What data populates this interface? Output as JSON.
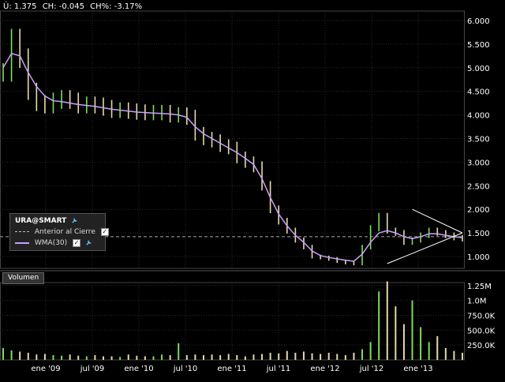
{
  "header": {
    "last_label": "Ú: 1.375",
    "change_label": "CH: -0.045",
    "change_pct_label": "CH%: -3.17%"
  },
  "legend": {
    "symbol": "URA@SMART",
    "prev_close_label": "Anterior al Cierre",
    "wma_label": "WMA(30)"
  },
  "volume_panel": {
    "title": "Volumen"
  },
  "colors": {
    "background": "#000000",
    "up": "#7ddc5a",
    "down": "#e8d8a8",
    "wma": "#c9a0ff",
    "grid": "#2a2a2a",
    "trendline": "#ffffff",
    "prev_close": "#aaaaaa"
  },
  "chart_data": [
    {
      "type": "line",
      "title": "",
      "subtype": "candlestick",
      "x_tick_labels": [
        "ene '09",
        "jul '09",
        "ene '10",
        "jul '10",
        "ene '11",
        "jul '11",
        "ene '12",
        "jul '12",
        "ene '13"
      ],
      "y_tick_labels": [
        "6.000",
        "5.500",
        "5.000",
        "4.500",
        "4.000",
        "3.500",
        "3.000",
        "2.500",
        "2.000",
        "1.500",
        "1.000"
      ],
      "ylim": [
        0.75,
        6.2
      ],
      "grid": true,
      "legend_placement": "bottom-left",
      "prev_close": 1.42,
      "series": [
        {
          "name": "URA@SMART",
          "x": [
            "2008-10",
            "2008-11",
            "2008-12",
            "2009-01",
            "2009-02",
            "2009-03",
            "2009-04",
            "2009-05",
            "2009-06",
            "2009-07",
            "2009-08",
            "2009-09",
            "2009-10",
            "2009-11",
            "2009-12",
            "2010-01",
            "2010-02",
            "2010-03",
            "2010-04",
            "2010-05",
            "2010-06",
            "2010-07",
            "2010-08",
            "2010-09",
            "2010-10",
            "2010-11",
            "2010-12",
            "2011-01",
            "2011-02",
            "2011-03",
            "2011-04",
            "2011-05",
            "2011-06",
            "2011-07",
            "2011-08",
            "2011-09",
            "2011-10",
            "2011-11",
            "2011-12",
            "2012-01",
            "2012-02",
            "2012-03",
            "2012-04",
            "2012-05",
            "2012-06",
            "2012-07",
            "2012-08",
            "2012-09",
            "2012-10",
            "2012-11",
            "2012-12",
            "2013-01",
            "2013-02",
            "2013-03",
            "2013-04",
            "2013-05"
          ],
          "values": [
            4.9,
            5.6,
            5.2,
            4.5,
            4.25,
            4.2,
            4.3,
            4.35,
            4.3,
            4.2,
            4.22,
            4.2,
            4.15,
            4.1,
            4.1,
            4.08,
            4.06,
            4.05,
            4.05,
            4.05,
            4.0,
            4.0,
            3.95,
            3.6,
            3.5,
            3.45,
            3.35,
            3.3,
            3.1,
            3.0,
            2.9,
            2.5,
            2.0,
            1.75,
            1.55,
            1.35,
            1.2,
            1.0,
            0.98,
            0.95,
            0.9,
            0.87,
            0.85,
            1.2,
            1.6,
            1.85,
            1.55,
            1.5,
            1.3,
            1.35,
            1.45,
            1.55,
            1.5,
            1.45,
            1.4,
            1.375
          ]
        },
        {
          "name": "WMA(30)",
          "values": [
            5.0,
            5.3,
            5.25,
            4.9,
            4.6,
            4.4,
            4.3,
            4.28,
            4.25,
            4.22,
            4.2,
            4.18,
            4.15,
            4.12,
            4.1,
            4.08,
            4.06,
            4.05,
            4.04,
            4.03,
            4.02,
            4.0,
            3.95,
            3.75,
            3.6,
            3.5,
            3.4,
            3.3,
            3.2,
            3.08,
            2.95,
            2.65,
            2.25,
            1.9,
            1.65,
            1.45,
            1.3,
            1.12,
            1.02,
            0.98,
            0.95,
            0.92,
            0.9,
            1.05,
            1.3,
            1.5,
            1.55,
            1.5,
            1.42,
            1.38,
            1.42,
            1.48,
            1.48,
            1.45,
            1.42,
            1.4
          ]
        }
      ]
    },
    {
      "type": "bar",
      "title": "Volumen",
      "y_tick_labels": [
        "1.25M",
        "1.0M",
        "750.0K",
        "500.0K",
        "250.0K"
      ],
      "ylim": [
        0,
        1300000
      ],
      "x": [
        "2008-10",
        "2008-11",
        "2008-12",
        "2009-01",
        "2009-02",
        "2009-03",
        "2009-04",
        "2009-05",
        "2009-06",
        "2009-07",
        "2009-08",
        "2009-09",
        "2009-10",
        "2009-11",
        "2009-12",
        "2010-01",
        "2010-02",
        "2010-03",
        "2010-04",
        "2010-05",
        "2010-06",
        "2010-07",
        "2010-08",
        "2010-09",
        "2010-10",
        "2010-11",
        "2010-12",
        "2011-01",
        "2011-02",
        "2011-03",
        "2011-04",
        "2011-05",
        "2011-06",
        "2011-07",
        "2011-08",
        "2011-09",
        "2011-10",
        "2011-11",
        "2011-12",
        "2012-01",
        "2012-02",
        "2012-03",
        "2012-04",
        "2012-05",
        "2012-06",
        "2012-07",
        "2012-08",
        "2012-09",
        "2012-10",
        "2012-11",
        "2012-12",
        "2013-01",
        "2013-02",
        "2013-03",
        "2013-04",
        "2013-05"
      ],
      "values": [
        200000,
        160000,
        140000,
        120000,
        90000,
        100000,
        80000,
        70000,
        90000,
        70000,
        60000,
        80000,
        60000,
        60000,
        50000,
        90000,
        70000,
        60000,
        60000,
        90000,
        80000,
        280000,
        80000,
        90000,
        80000,
        90000,
        80000,
        100000,
        80000,
        60000,
        90000,
        100000,
        120000,
        110000,
        150000,
        120000,
        140000,
        110000,
        100000,
        120000,
        100000,
        80000,
        120000,
        180000,
        300000,
        1150000,
        1320000,
        900000,
        600000,
        1000000,
        550000,
        300000,
        400000,
        200000,
        150000,
        120000
      ]
    }
  ]
}
